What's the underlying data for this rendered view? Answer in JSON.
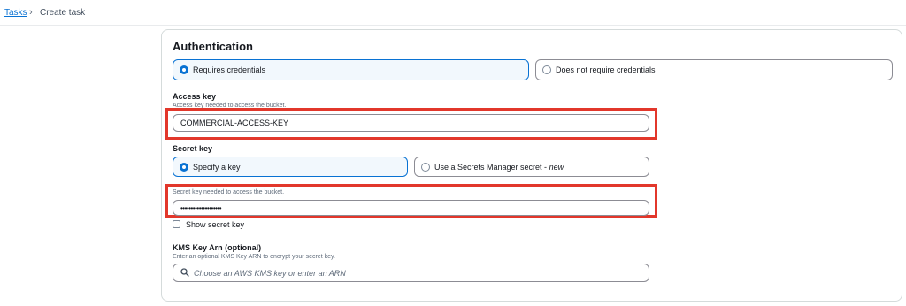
{
  "breadcrumb": {
    "link": "Tasks",
    "separator": "›",
    "current": "Create task"
  },
  "authentication": {
    "title": "Authentication",
    "options": [
      {
        "label": "Requires credentials",
        "selected": true
      },
      {
        "label": "Does not require credentials",
        "selected": false
      }
    ]
  },
  "access_key": {
    "label": "Access key",
    "description": "Access key needed to access the bucket.",
    "value": "COMMERCIAL-ACCESS-KEY"
  },
  "secret_key": {
    "label": "Secret key",
    "options": [
      {
        "label": "Specify a key",
        "selected": true
      },
      {
        "label": "Use a Secrets Manager secret - ",
        "label_em": "new",
        "selected": false
      }
    ],
    "description": "Secret key needed to access the bucket.",
    "value": "••••••••••••••••••••",
    "show_label": "Show secret key",
    "show_checked": false
  },
  "kms": {
    "label": "KMS Key Arn (optional)",
    "description": "Enter an optional KMS Key ARN to encrypt your secret key.",
    "placeholder": "Choose an AWS KMS key or enter an ARN"
  },
  "colors": {
    "accent": "#0972d3",
    "highlight": "#e2372b",
    "selected_bg": "#f2f8fd"
  }
}
